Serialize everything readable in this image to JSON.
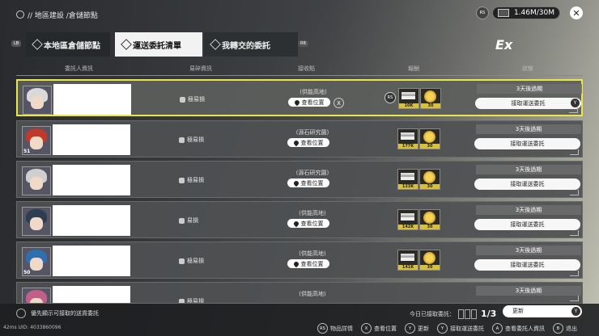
{
  "breadcrumb": "// 地區建設 /倉儲節點",
  "resource": {
    "rs": "RS",
    "value": "1.46M/30M"
  },
  "tabs": [
    {
      "label": "本地區倉儲節點"
    },
    {
      "label": "運送委託清單"
    },
    {
      "label": "我轉交的委託"
    }
  ],
  "lb": "LB",
  "rb": "RB",
  "logo": "Ex",
  "columns": [
    "委託人資訊",
    "易碎資訊",
    "接收點",
    "報酬",
    "狀態"
  ],
  "rows": [
    {
      "fragile": "極易損",
      "dest": "(供能高地)",
      "view": "查看位置",
      "reward1": "10K",
      "reward2": "30",
      "expire": "3天後過期",
      "accept": "接取運送委託",
      "level": "",
      "hair": "#d9d9d9"
    },
    {
      "fragile": "極易損",
      "dest": "(源石研究園)",
      "view": "查看位置",
      "reward1": "177K",
      "reward2": "30",
      "expire": "3天後過期",
      "accept": "接取運送委託",
      "level": "51",
      "hair": "#c0392b"
    },
    {
      "fragile": "極易損",
      "dest": "(源石研究園)",
      "view": "查看位置",
      "reward1": "123K",
      "reward2": "30",
      "expire": "3天後過期",
      "accept": "接取運送委託",
      "level": "",
      "hair": "#cfcfcf"
    },
    {
      "fragile": "易損",
      "dest": "(供能高地)",
      "view": "查看位置",
      "reward1": "142K",
      "reward2": "30",
      "expire": "3天後過期",
      "accept": "接取運送委託",
      "level": "",
      "hair": "#2c3e50"
    },
    {
      "fragile": "極易損",
      "dest": "(供能高地)",
      "view": "查看位置",
      "reward1": "141K",
      "reward2": "30",
      "expire": "3天後過期",
      "accept": "接取運送委託",
      "level": "50",
      "hair": "#2f6fb0"
    },
    {
      "fragile": "極易損",
      "dest": "(供能高地)",
      "view": "",
      "reward1": "",
      "reward2": "",
      "expire": "3天後過期",
      "accept": "",
      "level": "",
      "hair": "#c0608a"
    }
  ],
  "rs_small": "RS",
  "x_key": "X",
  "y_key": "Y",
  "hint": "優先顯示可接取的送貨委託",
  "uid": "42ms UID: 4033860096",
  "today_label": "今日已接取委託：",
  "today_count": "1/3",
  "refresh_label": "更新",
  "controls": [
    {
      "key": "RS",
      "label": "物品詳情"
    },
    {
      "key": "X",
      "label": "查看位置"
    },
    {
      "key": "Y",
      "label": "更新"
    },
    {
      "key": "Y",
      "label": "接取運送委託"
    },
    {
      "key": "A",
      "label": "查看委託人資訊"
    },
    {
      "key": "B",
      "label": "退出"
    }
  ]
}
